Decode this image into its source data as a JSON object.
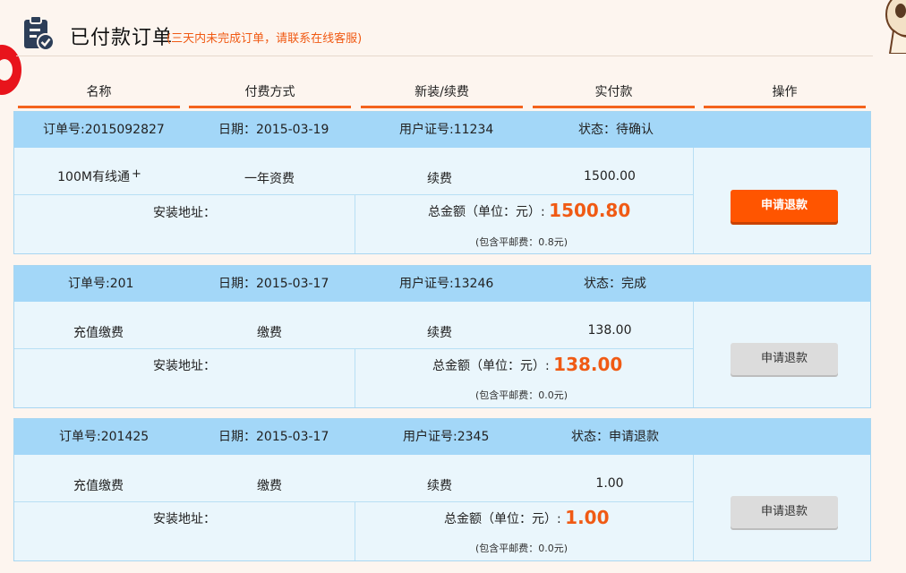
{
  "header": {
    "title": "已付款订单",
    "note": "(三天内未完成订单，请联系在线客服)"
  },
  "columns": [
    "名称",
    "付费方式",
    "新装/续费",
    "实付款",
    "操作"
  ],
  "orders": [
    {
      "order_no": "订单号:2015092827",
      "date": "日期：2015-03-19",
      "user_id": "用户证号:11234",
      "status": "状态：待确认",
      "name": "100M有线通",
      "name_sup": "+",
      "payment_method": "一年资费",
      "type": "续费",
      "amount": "1500.00",
      "address_label": "安装地址：",
      "total_label": "总金额（单位：元）:",
      "total": "1500.80",
      "postage": "(包含平邮费：0.8元)",
      "refund_label": "申请退款",
      "refund_active": true
    },
    {
      "order_no": "订单号:201",
      "date": "日期：2015-03-17",
      "user_id": "用户证号:13246",
      "status": "状态：完成",
      "name": "充值缴费",
      "name_sup": "",
      "payment_method": "缴费",
      "type": "续费",
      "amount": "138.00",
      "address_label": "安装地址：",
      "total_label": "总金额（单位：元）:",
      "total": "138.00",
      "postage": "(包含平邮费：0.0元)",
      "refund_label": "申请退款",
      "refund_active": false
    },
    {
      "order_no": "订单号:201425",
      "date": "日期：2015-03-17",
      "user_id": "用户证号:2345",
      "status": "状态：申请退款",
      "name": "充值缴费",
      "name_sup": "",
      "payment_method": "缴费",
      "type": "续费",
      "amount": "1.00",
      "address_label": "安装地址：",
      "total_label": "总金额（单位：元）:",
      "total": "1.00",
      "postage": "(包含平邮费：0.0元)",
      "refund_label": "申请退款",
      "refund_active": false
    }
  ],
  "colors": {
    "accent": "#f05a14",
    "button_active": "#ff5500",
    "row_header": "#a3d7f8",
    "row_body": "#eaf6fc"
  }
}
